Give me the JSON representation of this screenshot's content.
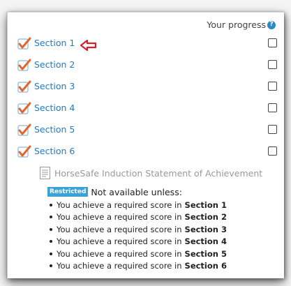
{
  "header": {
    "progress_label": "Your progress",
    "help_icon": "help-icon"
  },
  "sections": [
    {
      "label": "Section 1",
      "checked": true,
      "complete": false
    },
    {
      "label": "Section 2",
      "checked": true,
      "complete": false
    },
    {
      "label": "Section 3",
      "checked": true,
      "complete": false
    },
    {
      "label": "Section 4",
      "checked": true,
      "complete": false
    },
    {
      "label": "Section 5",
      "checked": true,
      "complete": false
    },
    {
      "label": "Section 6",
      "checked": true,
      "complete": false
    }
  ],
  "certificate": {
    "label": "HorseSafe Induction Statement of Achievement",
    "icon": "document-icon"
  },
  "restriction": {
    "badge": "Restricted",
    "text": "Not available unless:",
    "conditions": [
      {
        "prefix": "You achieve a required score in",
        "target": "Section 1"
      },
      {
        "prefix": "You achieve a required score in",
        "target": "Section 2"
      },
      {
        "prefix": "You achieve a required score in",
        "target": "Section 3"
      },
      {
        "prefix": "You achieve a required score in",
        "target": "Section 4"
      },
      {
        "prefix": "You achieve a required score in",
        "target": "Section 5"
      },
      {
        "prefix": "You achieve a required score in",
        "target": "Section 6"
      }
    ]
  },
  "colors": {
    "link": "#1f7ac0",
    "badge": "#3aa2d6",
    "arrow": "#d8202a",
    "checkmark": "#e0672a"
  }
}
